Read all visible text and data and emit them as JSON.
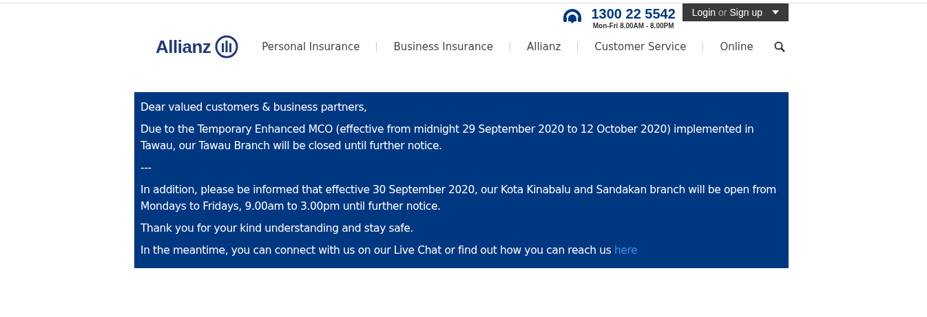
{
  "header": {
    "phone": "1300 22 5542",
    "hours": "Mon-Fri 8.00AM - 8.00PM",
    "login": {
      "login": "Login",
      "or": "or",
      "signup": "Sign up"
    }
  },
  "nav": {
    "logo": "Allianz",
    "items": [
      "Personal Insurance",
      "Business Insurance",
      "Allianz",
      "Customer Service",
      "Online"
    ]
  },
  "notice": {
    "paragraphs": [
      "Dear valued customers & business partners,",
      "Due to the Temporary Enhanced MCO (effective from midnight 29 September 2020 to 12 October 2020) implemented in Tawau, our Tawau Branch will be closed until further notice.",
      "---",
      "In addition, please be informed that effective 30 September 2020, our Kota Kinabalu and Sandakan branch will be open from Mondays to Fridays, 9.00am to 3.00pm until further notice.",
      "Thank you for your kind understanding and stay safe."
    ],
    "last": {
      "text": "In the meantime, you can connect with us on our Live Chat or find out how you can reach us",
      "link": "here"
    }
  }
}
